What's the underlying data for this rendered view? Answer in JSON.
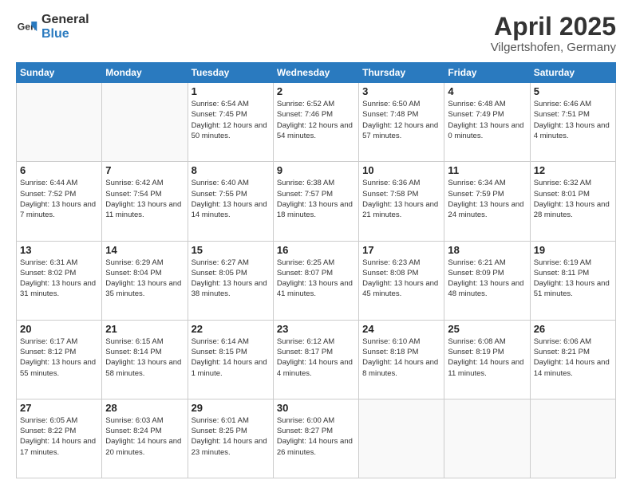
{
  "logo": {
    "general": "General",
    "blue": "Blue"
  },
  "title": {
    "month": "April 2025",
    "location": "Vilgertshofen, Germany"
  },
  "weekdays": [
    "Sunday",
    "Monday",
    "Tuesday",
    "Wednesday",
    "Thursday",
    "Friday",
    "Saturday"
  ],
  "weeks": [
    [
      {
        "day": "",
        "info": ""
      },
      {
        "day": "",
        "info": ""
      },
      {
        "day": "1",
        "info": "Sunrise: 6:54 AM\nSunset: 7:45 PM\nDaylight: 12 hours and 50 minutes."
      },
      {
        "day": "2",
        "info": "Sunrise: 6:52 AM\nSunset: 7:46 PM\nDaylight: 12 hours and 54 minutes."
      },
      {
        "day": "3",
        "info": "Sunrise: 6:50 AM\nSunset: 7:48 PM\nDaylight: 12 hours and 57 minutes."
      },
      {
        "day": "4",
        "info": "Sunrise: 6:48 AM\nSunset: 7:49 PM\nDaylight: 13 hours and 0 minutes."
      },
      {
        "day": "5",
        "info": "Sunrise: 6:46 AM\nSunset: 7:51 PM\nDaylight: 13 hours and 4 minutes."
      }
    ],
    [
      {
        "day": "6",
        "info": "Sunrise: 6:44 AM\nSunset: 7:52 PM\nDaylight: 13 hours and 7 minutes."
      },
      {
        "day": "7",
        "info": "Sunrise: 6:42 AM\nSunset: 7:54 PM\nDaylight: 13 hours and 11 minutes."
      },
      {
        "day": "8",
        "info": "Sunrise: 6:40 AM\nSunset: 7:55 PM\nDaylight: 13 hours and 14 minutes."
      },
      {
        "day": "9",
        "info": "Sunrise: 6:38 AM\nSunset: 7:57 PM\nDaylight: 13 hours and 18 minutes."
      },
      {
        "day": "10",
        "info": "Sunrise: 6:36 AM\nSunset: 7:58 PM\nDaylight: 13 hours and 21 minutes."
      },
      {
        "day": "11",
        "info": "Sunrise: 6:34 AM\nSunset: 7:59 PM\nDaylight: 13 hours and 24 minutes."
      },
      {
        "day": "12",
        "info": "Sunrise: 6:32 AM\nSunset: 8:01 PM\nDaylight: 13 hours and 28 minutes."
      }
    ],
    [
      {
        "day": "13",
        "info": "Sunrise: 6:31 AM\nSunset: 8:02 PM\nDaylight: 13 hours and 31 minutes."
      },
      {
        "day": "14",
        "info": "Sunrise: 6:29 AM\nSunset: 8:04 PM\nDaylight: 13 hours and 35 minutes."
      },
      {
        "day": "15",
        "info": "Sunrise: 6:27 AM\nSunset: 8:05 PM\nDaylight: 13 hours and 38 minutes."
      },
      {
        "day": "16",
        "info": "Sunrise: 6:25 AM\nSunset: 8:07 PM\nDaylight: 13 hours and 41 minutes."
      },
      {
        "day": "17",
        "info": "Sunrise: 6:23 AM\nSunset: 8:08 PM\nDaylight: 13 hours and 45 minutes."
      },
      {
        "day": "18",
        "info": "Sunrise: 6:21 AM\nSunset: 8:09 PM\nDaylight: 13 hours and 48 minutes."
      },
      {
        "day": "19",
        "info": "Sunrise: 6:19 AM\nSunset: 8:11 PM\nDaylight: 13 hours and 51 minutes."
      }
    ],
    [
      {
        "day": "20",
        "info": "Sunrise: 6:17 AM\nSunset: 8:12 PM\nDaylight: 13 hours and 55 minutes."
      },
      {
        "day": "21",
        "info": "Sunrise: 6:15 AM\nSunset: 8:14 PM\nDaylight: 13 hours and 58 minutes."
      },
      {
        "day": "22",
        "info": "Sunrise: 6:14 AM\nSunset: 8:15 PM\nDaylight: 14 hours and 1 minute."
      },
      {
        "day": "23",
        "info": "Sunrise: 6:12 AM\nSunset: 8:17 PM\nDaylight: 14 hours and 4 minutes."
      },
      {
        "day": "24",
        "info": "Sunrise: 6:10 AM\nSunset: 8:18 PM\nDaylight: 14 hours and 8 minutes."
      },
      {
        "day": "25",
        "info": "Sunrise: 6:08 AM\nSunset: 8:19 PM\nDaylight: 14 hours and 11 minutes."
      },
      {
        "day": "26",
        "info": "Sunrise: 6:06 AM\nSunset: 8:21 PM\nDaylight: 14 hours and 14 minutes."
      }
    ],
    [
      {
        "day": "27",
        "info": "Sunrise: 6:05 AM\nSunset: 8:22 PM\nDaylight: 14 hours and 17 minutes."
      },
      {
        "day": "28",
        "info": "Sunrise: 6:03 AM\nSunset: 8:24 PM\nDaylight: 14 hours and 20 minutes."
      },
      {
        "day": "29",
        "info": "Sunrise: 6:01 AM\nSunset: 8:25 PM\nDaylight: 14 hours and 23 minutes."
      },
      {
        "day": "30",
        "info": "Sunrise: 6:00 AM\nSunset: 8:27 PM\nDaylight: 14 hours and 26 minutes."
      },
      {
        "day": "",
        "info": ""
      },
      {
        "day": "",
        "info": ""
      },
      {
        "day": "",
        "info": ""
      }
    ]
  ]
}
